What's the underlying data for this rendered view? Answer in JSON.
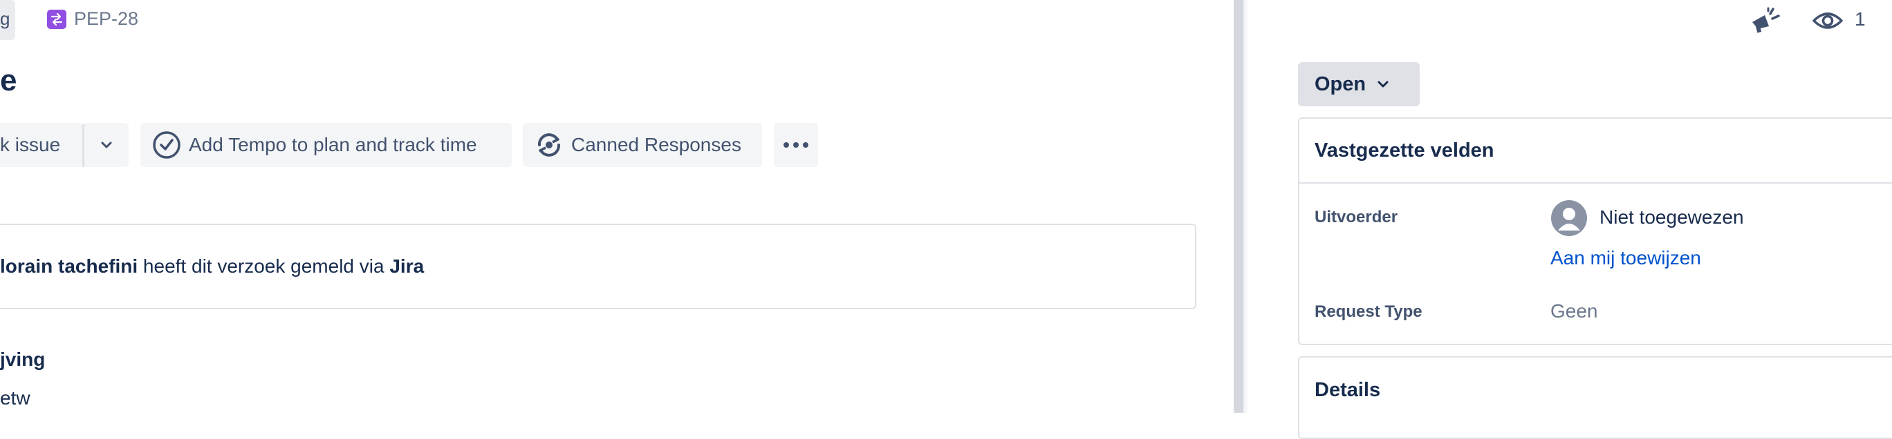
{
  "breadcrumb": {
    "prev_chip": "g",
    "issue_key": "PEP-28"
  },
  "issue": {
    "title_fragment": "e"
  },
  "toolbar": {
    "link_issue": "k issue",
    "add_tempo": "Add Tempo to plan and track time",
    "canned_responses": "Canned Responses"
  },
  "reporter": {
    "name": "lorain tachefini",
    "middle": " heeft dit verzoek gemeld via ",
    "channel": "Jira"
  },
  "description": {
    "heading": "jving",
    "text": "etw"
  },
  "header_actions": {
    "watch_count": "1"
  },
  "status": {
    "label": "Open"
  },
  "pinned_panel": {
    "title": "Vastgezette velden",
    "assignee_label": "Uitvoerder",
    "assignee_value": "Niet toegewezen",
    "assign_me": "Aan mij toewijzen",
    "request_type_label": "Request Type",
    "request_type_value": "Geen"
  },
  "details_panel": {
    "title": "Details"
  },
  "icons": {
    "issue_type": "subtask-arrows-icon",
    "caret": "chevron-down-icon",
    "tempo": "check-circle-icon",
    "canned": "refresh-chat-icon",
    "more": "more-horizontal-icon",
    "announce": "megaphone-icon",
    "watch": "eye-icon",
    "avatar": "default-user-avatar-icon"
  },
  "colors": {
    "text": "#172b4d",
    "muted": "#42526e",
    "link": "#0052cc",
    "issue_type": "#904ee2",
    "chip_bg": "#f4f5f7",
    "border": "#dfe1e6"
  }
}
